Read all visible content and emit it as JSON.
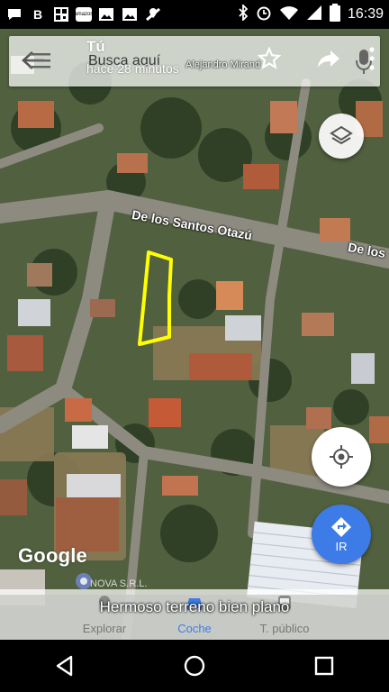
{
  "status_bar": {
    "time": "16:39",
    "left_icons": [
      "chat-icon",
      "b-icon",
      "qr-icon",
      "amazon-icon",
      "image-icon",
      "image-icon",
      "maps-icon"
    ],
    "right_icons": [
      "bluetooth-icon",
      "alarm-icon",
      "wifi-icon",
      "signal-icon",
      "battery-icon"
    ],
    "badge_b": "B",
    "amazon_label": "amazon"
  },
  "search_bar": {
    "title": "Tú",
    "subtitle": "hace 28 minutos",
    "placeholder": "Busca aquí"
  },
  "map": {
    "road_label_main": "De los Santos Otazú",
    "road_label_right": "De los",
    "road_label_top": "Alejandro Mirand",
    "google_logo": "Google",
    "bottom_place": "NOVA S.R.L.",
    "go_label": "IR",
    "highlight_color": "#ffff00"
  },
  "tabs": [
    {
      "label": "Explorar",
      "icon": "explore-pin-icon"
    },
    {
      "label": "Coche",
      "icon": "car-icon",
      "active": true
    },
    {
      "label": "T. público",
      "icon": "bus-icon"
    }
  ],
  "caption": "Hermoso terreno bien plano",
  "colors": {
    "accent": "#3d7be6",
    "highlight": "#ffff00"
  }
}
